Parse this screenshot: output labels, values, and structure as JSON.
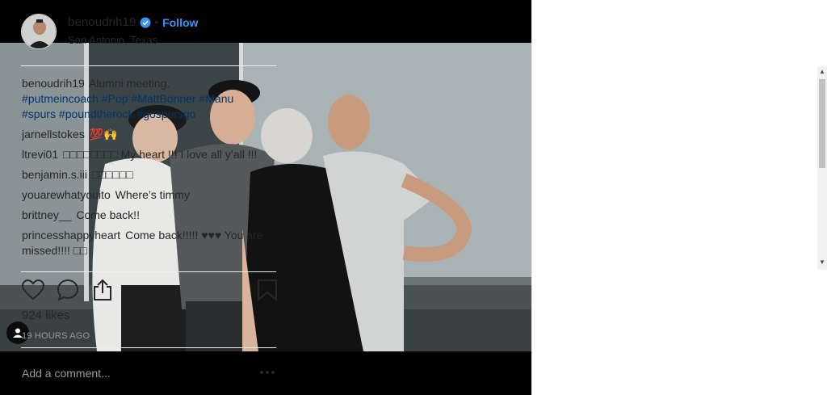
{
  "post": {
    "username": "benoudrih19",
    "verified_icon": "verified-badge-icon",
    "separator": "•",
    "follow_label": "Follow",
    "location": "San Antonio, Texas",
    "accent_color": "#3897f0"
  },
  "caption": {
    "username": "benoudrih19",
    "text": "Alumni meeting.",
    "hashtags_line1": "#putmeincoach #Pop #MattBonner #Manu",
    "hashtags_line2": "#spurs #poundtherock #gospursgo"
  },
  "comments": [
    {
      "user": "jarnellstokes",
      "text": "💯🙌"
    },
    {
      "user": "ltrevi01",
      "text": "□□□□□□□□ My heart !!! I love all y’all !!!"
    },
    {
      "user": "benjamin.s.iii",
      "text": "□□□□□□"
    },
    {
      "user": "youarewhatyouito",
      "text": "Where’s timmy"
    },
    {
      "user": "brittney__",
      "text": "Come back!!"
    },
    {
      "user": "princesshappyheart",
      "text": "Come back!!!!! ♥♥♥ You are missed!!!! □□"
    }
  ],
  "actions": {
    "like": "heart-icon",
    "comment": "comment-icon",
    "share": "share-icon",
    "save": "bookmark-icon"
  },
  "likes_text": "924 likes",
  "timestamp": "19 HOURS AGO",
  "add_comment_placeholder": "Add a comment...",
  "more_icon": "more-options-icon"
}
